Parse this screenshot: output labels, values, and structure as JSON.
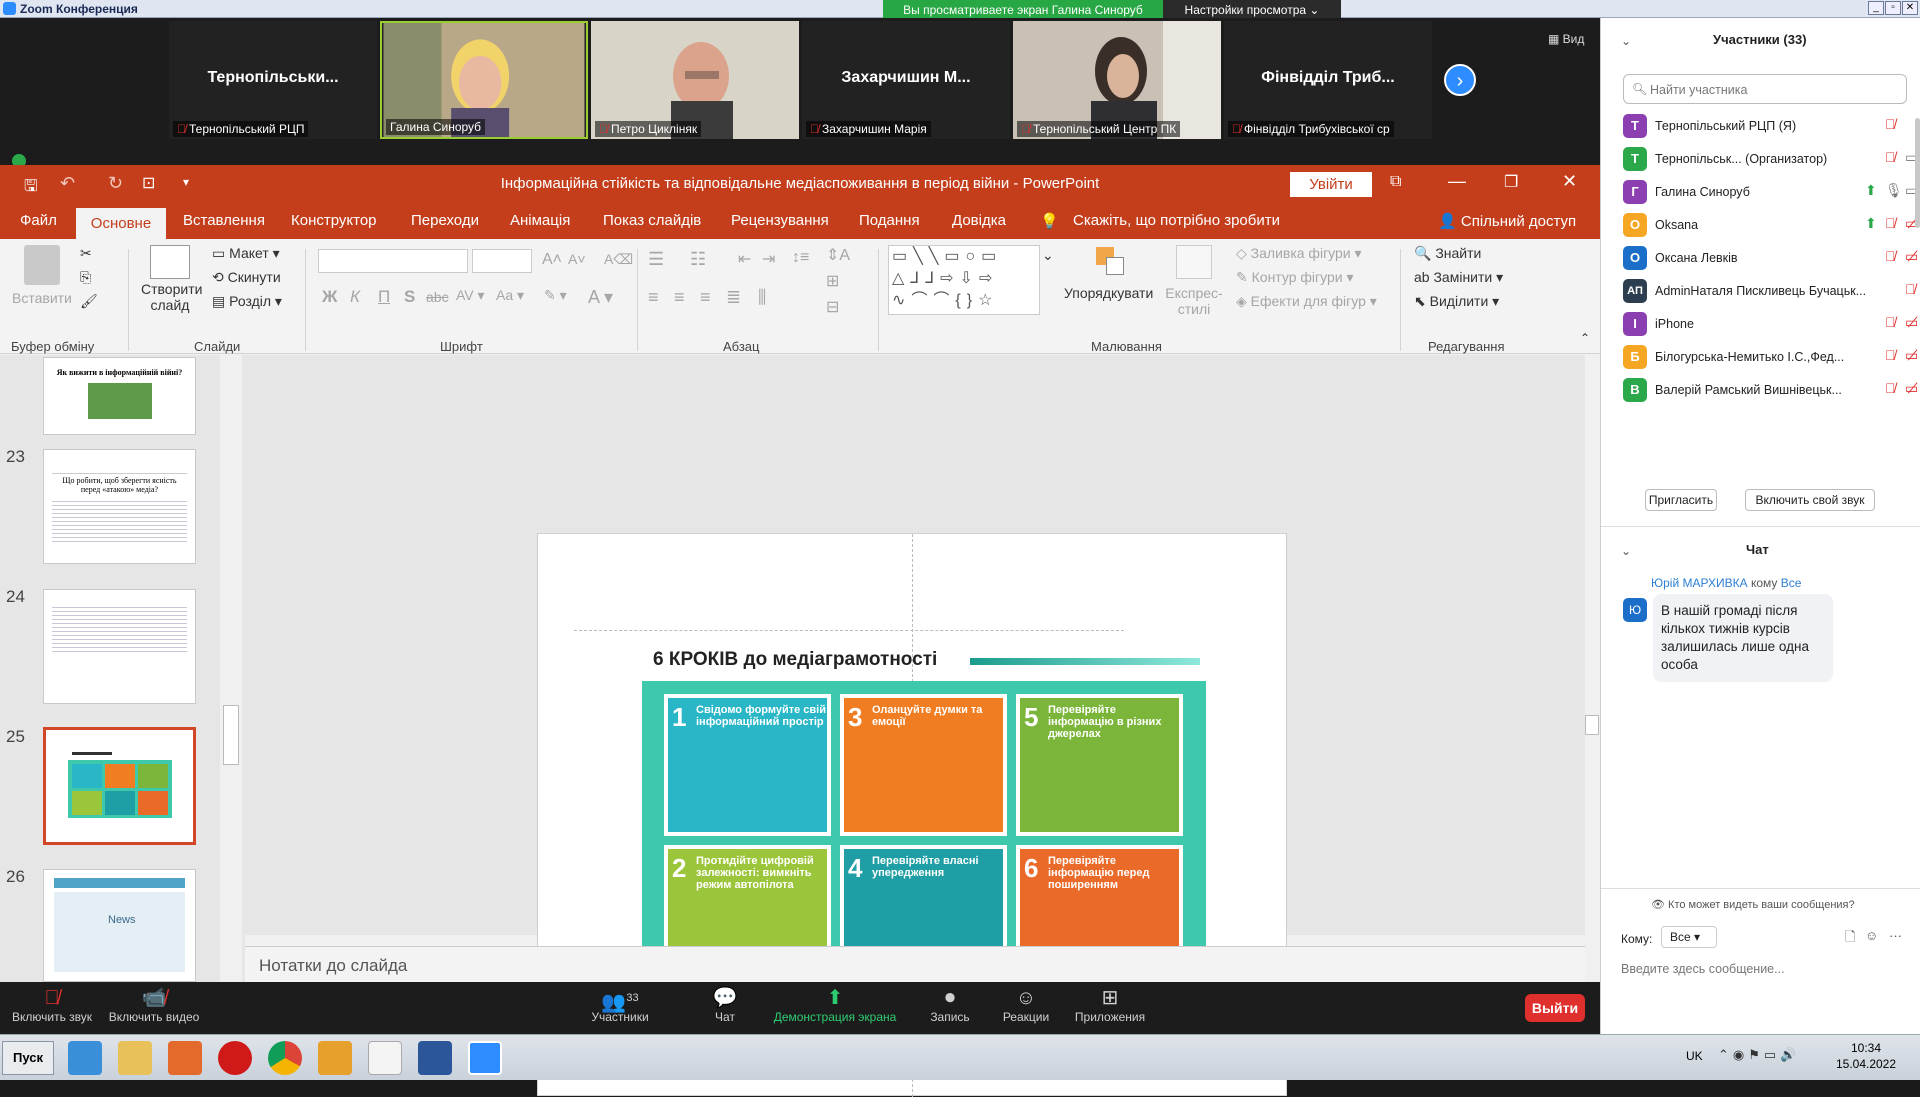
{
  "zoom": {
    "window_title": "Zoom Конференция",
    "share_banner": "Вы просматриваете экран Галина Синоруб",
    "view_options": "Настройки просмотра ⌄",
    "view_label": "Вид",
    "tiles": [
      {
        "name_large": "Тернопільськи...",
        "label": "Тернопільський РЦП",
        "muted": true,
        "has_video": false
      },
      {
        "name_large": "",
        "label": "Галина Синоруб",
        "muted": false,
        "has_video": true
      },
      {
        "name_large": "",
        "label": "Петро Цикліняк",
        "muted": true,
        "has_video": true
      },
      {
        "name_large": "Захарчишин М...",
        "label": "Захарчишин Марія",
        "muted": true,
        "has_video": false
      },
      {
        "name_large": "",
        "label": "Тернопільський Центр ПК",
        "muted": true,
        "has_video": true
      },
      {
        "name_large": "Фінвідділ Триб...",
        "label": "Фінвідділ Трибухівської ср",
        "muted": true,
        "has_video": false
      }
    ],
    "toolbar": {
      "mute": "Включить звук",
      "video": "Включить видео",
      "participants": "Участники",
      "participants_count": "33",
      "chat": "Чат",
      "share": "Демонстрация экрана",
      "record": "Запись",
      "reactions": "Реакции",
      "apps": "Приложения",
      "exit": "Выйти"
    }
  },
  "powerpoint": {
    "title": "Інформаційна стійкість та відповідальне медіаспоживання в період війни  -  PowerPoint",
    "signin": "Увійти",
    "tabs": [
      "Файл",
      "Основне",
      "Вставлення",
      "Конструктор",
      "Переходи",
      "Анімація",
      "Показ слайдів",
      "Рецензування",
      "Подання",
      "Довідка"
    ],
    "tell_me": "Скажіть, що потрібно зробити",
    "share": "Спільний доступ",
    "ribbon": {
      "paste": "Вставити",
      "clipboard": "Буфер обміну",
      "new_slide": "Створити слайд",
      "layout": "Макет",
      "reset": "Скинути",
      "section": "Розділ",
      "slides": "Слайди",
      "bold": "Ж",
      "italic": "К",
      "underline": "П",
      "strike": "S",
      "font": "Шрифт",
      "paragraph": "Абзац",
      "arrange": "Упорядкувати",
      "quick_styles": "Експрес-стилі",
      "shape_fill": "Заливка фігури",
      "shape_outline": "Контур фігури",
      "shape_effects": "Ефекти для фігур",
      "drawing": "Малювання",
      "find": "Знайти",
      "replace": "Замінити",
      "select": "Виділити",
      "editing": "Редагування"
    },
    "thumb_numbers": [
      "23",
      "24",
      "25",
      "26"
    ],
    "thumb_22_title": "Як вижити в інформаційній війні?",
    "thumb_23_heading": "Що робити, щоб зберегти ясність перед «атакою» медіа?",
    "thumb_26_label": "News",
    "notes": "Нотатки до слайда",
    "slide": {
      "title": "6 КРОКІВ до медіаграмотності",
      "cards": [
        {
          "num": "1",
          "text": "Свідомо формуйте свій інформаційний простір",
          "color": "#29b7c7"
        },
        {
          "num": "3",
          "text": "Оланцуйте думки та емоції",
          "color": "#f07d22"
        },
        {
          "num": "5",
          "text": "Перевіряйте інформацію в різних джерелах",
          "color": "#7bb63a"
        },
        {
          "num": "2",
          "text": "Протидійте цифровій залежності: вимкніть режим автопілота",
          "color": "#9bc63b"
        },
        {
          "num": "4",
          "text": "Перевіряйте власні упередження",
          "color": "#1f9ea5"
        },
        {
          "num": "6",
          "text": "Перевіряйте інформацію перед поширенням",
          "color": "#ea6a2a"
        }
      ]
    }
  },
  "participants": {
    "header": "Участники (33)",
    "search_placeholder": "Найти участника",
    "list": [
      {
        "initial": "Т",
        "name": "Тернопільський РЦП (Я)",
        "color": "#8b3fb0"
      },
      {
        "initial": "Т",
        "name": "Тернопільськ...  (Организатор)",
        "color": "#2aa84a"
      },
      {
        "initial": "Г",
        "name": "Галина Синоруб",
        "color": "#8b3fb0"
      },
      {
        "initial": "O",
        "name": "Oksana",
        "color": "#f5a623"
      },
      {
        "initial": "О",
        "name": " Оксана Левків",
        "color": "#1b6fc9"
      },
      {
        "initial": "АП",
        "name": "AdminНаталя Пискливець Бучацьк...",
        "color": "#2c3e50"
      },
      {
        "initial": "I",
        "name": "iPhone",
        "color": "#8b3fb0"
      },
      {
        "initial": "Б",
        "name": "Білогурська-Немитько І.С.,Фед...",
        "color": "#f5a623"
      },
      {
        "initial": "В",
        "name": "Валерій Рамський Вишнівецьк...",
        "color": "#2aa84a"
      }
    ],
    "invite": "Пригласить",
    "unmute_me": "Включить свой звук"
  },
  "chat": {
    "header": "Чат",
    "sender": "Юрій МАРХИВКА",
    "to_word": "кому",
    "to": "Все",
    "avatar": "Ю",
    "message": "В нашій громаді після кількох тижнів курсів залишилась лише одна особа",
    "who_can_see": "Кто может видеть ваши сообщения?",
    "to_label": "Кому:",
    "to_select": "Все",
    "input_placeholder": "Введите здесь сообщение..."
  },
  "taskbar": {
    "start": "Пуск",
    "lang": "UK",
    "time": "10:34",
    "date": "15.04.2022"
  }
}
